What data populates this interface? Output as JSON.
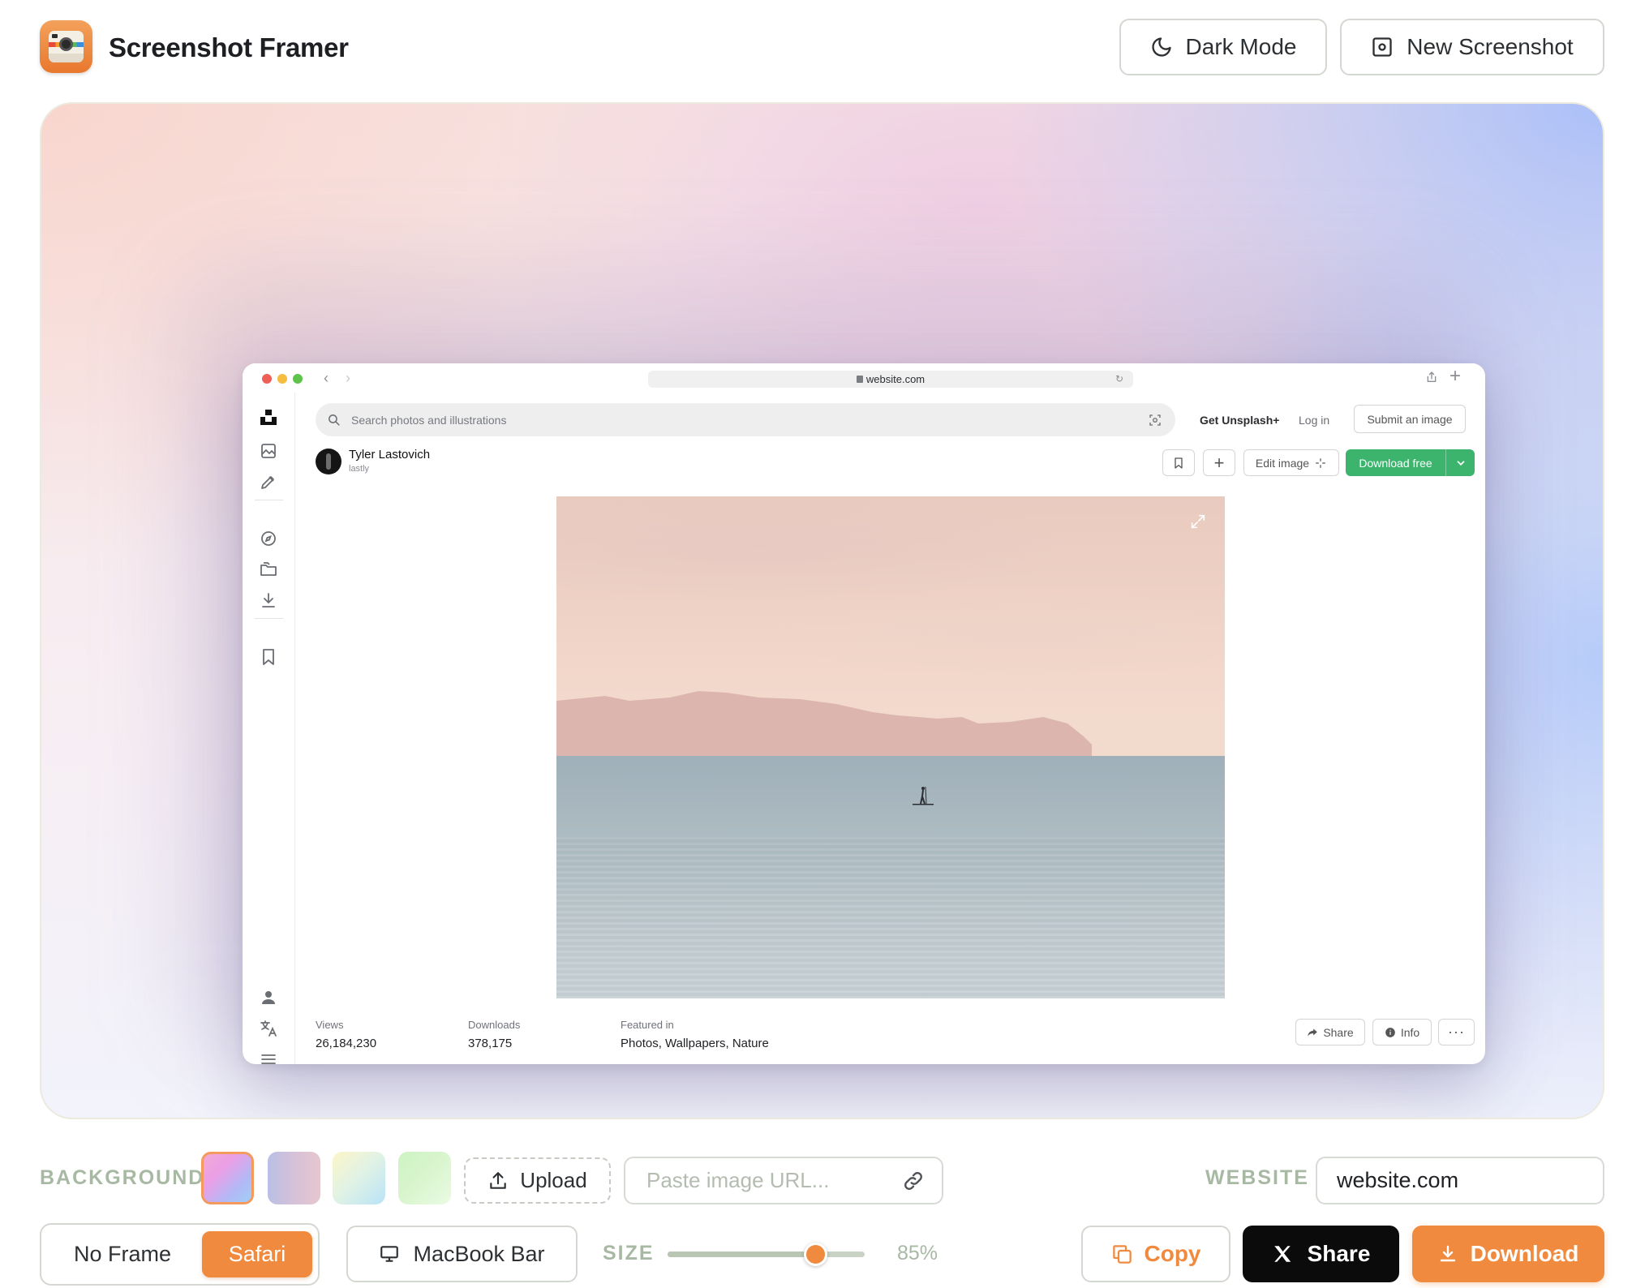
{
  "header": {
    "title": "Screenshot Framer",
    "dark_mode_label": "Dark Mode",
    "new_screenshot_label": "New Screenshot"
  },
  "browser": {
    "url": "website.com",
    "search_placeholder": "Search photos and illustrations",
    "nav": {
      "unsplash_plus": "Get Unsplash+",
      "login": "Log in",
      "submit": "Submit an image"
    },
    "author": {
      "name": "Tyler Lastovich",
      "handle": "lastly"
    },
    "actions": {
      "edit": "Edit image",
      "download": "Download free"
    },
    "stats": [
      {
        "label": "Views",
        "value": "26,184,230"
      },
      {
        "label": "Downloads",
        "value": "378,175"
      },
      {
        "label": "Featured in",
        "value": "Photos, Wallpapers, Nature"
      }
    ],
    "footer": {
      "share": "Share",
      "info": "Info",
      "more": "···"
    }
  },
  "controls": {
    "background_label": "BACKGROUND",
    "upload_label": "Upload",
    "url_placeholder": "Paste image URL...",
    "website_label": "WEBSITE",
    "website_value": "website.com",
    "frame": {
      "no_frame": "No Frame",
      "safari": "Safari",
      "selected": "Safari"
    },
    "macbook_bar_label": "MacBook Bar",
    "size_label": "SIZE",
    "size_value": "85%",
    "size_fraction": 0.75,
    "copy_label": "Copy",
    "share_label": "Share",
    "download_label": "Download"
  },
  "colors": {
    "accent": "#f08a3e",
    "muted_label": "#a7b9a3",
    "unsplash_green": "#3cb46e"
  }
}
